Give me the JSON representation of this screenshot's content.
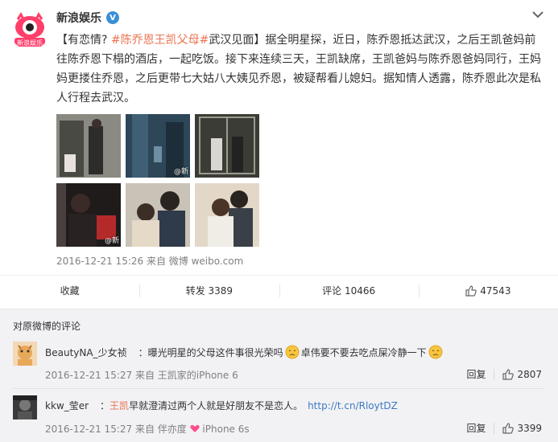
{
  "post": {
    "author": "新浪娱乐",
    "verified_badge": "V",
    "avatar_logo_text": "新浪娱乐",
    "text_prefix": "【有恋情? ",
    "topic_tag": "#陈乔恩王凯父母#",
    "text_body": "武汉见面】据全明星探，近日，陈乔恩抵达武汉，之后王凯爸妈前往陈乔恩下榻的酒店，一起吃饭。接下来连续三天，王凯缺席，王凯爸妈与陈乔恩爸妈同行，王妈妈更搂住乔恩，之后更带七大姑八大姨见乔恩，被疑帮看儿媳妇。据知情人透露，陈乔恩此次是私人行程去武汉。",
    "photo_watermark_1": "@新",
    "photo_watermark_2": "@新",
    "meta": "2016-12-21 15:26 来自 微博 weibo.com"
  },
  "actions": {
    "favorite": "收藏",
    "repost": "转发 3389",
    "comment": "评论 10466",
    "like": "47543"
  },
  "comments_section": {
    "title": "对原微博的评论",
    "comments": [
      {
        "nick": "BeautyNA_少女祯",
        "body_1": "：曝光明星的父母这件事很光荣吗",
        "body_2": "卓伟要不要去吃点屎冷静一下",
        "meta": "2016-12-21 15:27 来自 王凯家的iPhone 6",
        "reply": "回复",
        "likes": "2807"
      },
      {
        "nick": "kkw_莹er",
        "colon": "：",
        "mention": "王凯",
        "body": "早就澄清过两个人就是好朋友不是恋人。",
        "url": "http://t.cn/RloytDZ",
        "meta_prefix": "2016-12-21 15:27 来自 伴亦度",
        "meta_suffix": "iPhone 6s",
        "reply": "回复",
        "likes": "3399"
      }
    ]
  },
  "colors": {
    "accent": "#eb7350",
    "link": "#3d7bbf",
    "verified": "#3a8fd6"
  }
}
